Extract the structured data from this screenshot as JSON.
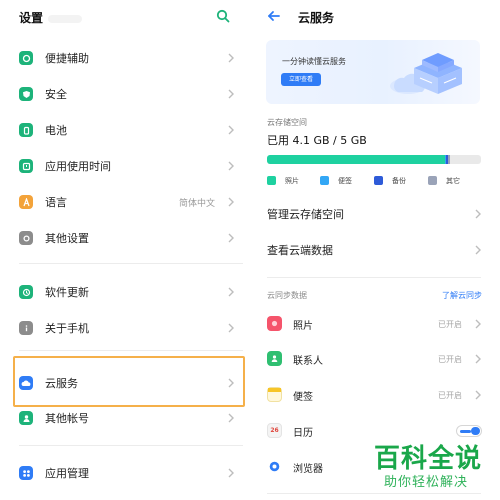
{
  "left": {
    "title": "设置",
    "items": [
      {
        "label": "便捷辅助",
        "value": "",
        "icon": "accessibility-icon",
        "color": "#1db37a"
      },
      {
        "label": "安全",
        "value": "",
        "icon": "shield-icon",
        "color": "#1db37a"
      },
      {
        "label": "电池",
        "value": "",
        "icon": "battery-icon",
        "color": "#1db37a"
      },
      {
        "label": "应用使用时间",
        "value": "",
        "icon": "app-usage-icon",
        "color": "#1db37a"
      },
      {
        "label": "语言",
        "value": "简体中文",
        "icon": "language-icon",
        "color": "#f3a33a"
      },
      {
        "label": "其他设置",
        "value": "",
        "icon": "other-settings-icon",
        "color": "#8c8c8c"
      },
      {
        "label": "软件更新",
        "value": "",
        "icon": "software-update-icon",
        "color": "#1db37a"
      },
      {
        "label": "关于手机",
        "value": "",
        "icon": "about-phone-icon",
        "color": "#8c8c8c"
      },
      {
        "label": "云服务",
        "value": "",
        "icon": "cloud-icon",
        "color": "#2f7cf6"
      },
      {
        "label": "其他帐号",
        "value": "",
        "icon": "account-icon",
        "color": "#1db37a"
      },
      {
        "label": "应用管理",
        "value": "",
        "icon": "app-management-icon",
        "color": "#2f7cf6"
      }
    ]
  },
  "right": {
    "title": "云服务",
    "banner": {
      "text": "一分钟读懂云服务",
      "button": "立即查看"
    },
    "storage": {
      "label": "云存储空间",
      "used_text": "已用 4.1 GB / 5 GB",
      "used_fraction": 0.82,
      "segments": [
        {
          "name": "照片",
          "fraction": 0.83,
          "color": "#1ed1a0"
        },
        {
          "name": "便签",
          "fraction": 0.003,
          "color": "#33a7f5"
        },
        {
          "name": "备份",
          "fraction": 0.01,
          "color": "#2e5bd8"
        },
        {
          "name": "其它",
          "fraction": 0.004,
          "color": "#9aa3b8"
        }
      ]
    },
    "menu": [
      {
        "label": "管理云存储空间"
      },
      {
        "label": "查看云端数据"
      }
    ],
    "sync": {
      "header": "云同步数据",
      "link": "了解云同步",
      "items": [
        {
          "label": "照片",
          "value": "已开启",
          "icon": "photos-icon",
          "color": "#f5546b",
          "control": "chevron"
        },
        {
          "label": "联系人",
          "value": "已开启",
          "icon": "contacts-icon",
          "color": "#2fbf71",
          "control": "chevron"
        },
        {
          "label": "便签",
          "value": "已开启",
          "icon": "notes-icon",
          "color": "#f7c528",
          "control": "chevron"
        },
        {
          "label": "日历",
          "value": "",
          "icon": "calendar-icon",
          "color": "#f0f0f0",
          "control": "toggle",
          "calendar_day": "26"
        },
        {
          "label": "浏览器",
          "value": "",
          "icon": "browser-icon",
          "color": "#2f7cf6",
          "control": "toggle"
        }
      ]
    }
  },
  "watermark": {
    "main": "百科全说",
    "sub": "助你轻松解决"
  }
}
